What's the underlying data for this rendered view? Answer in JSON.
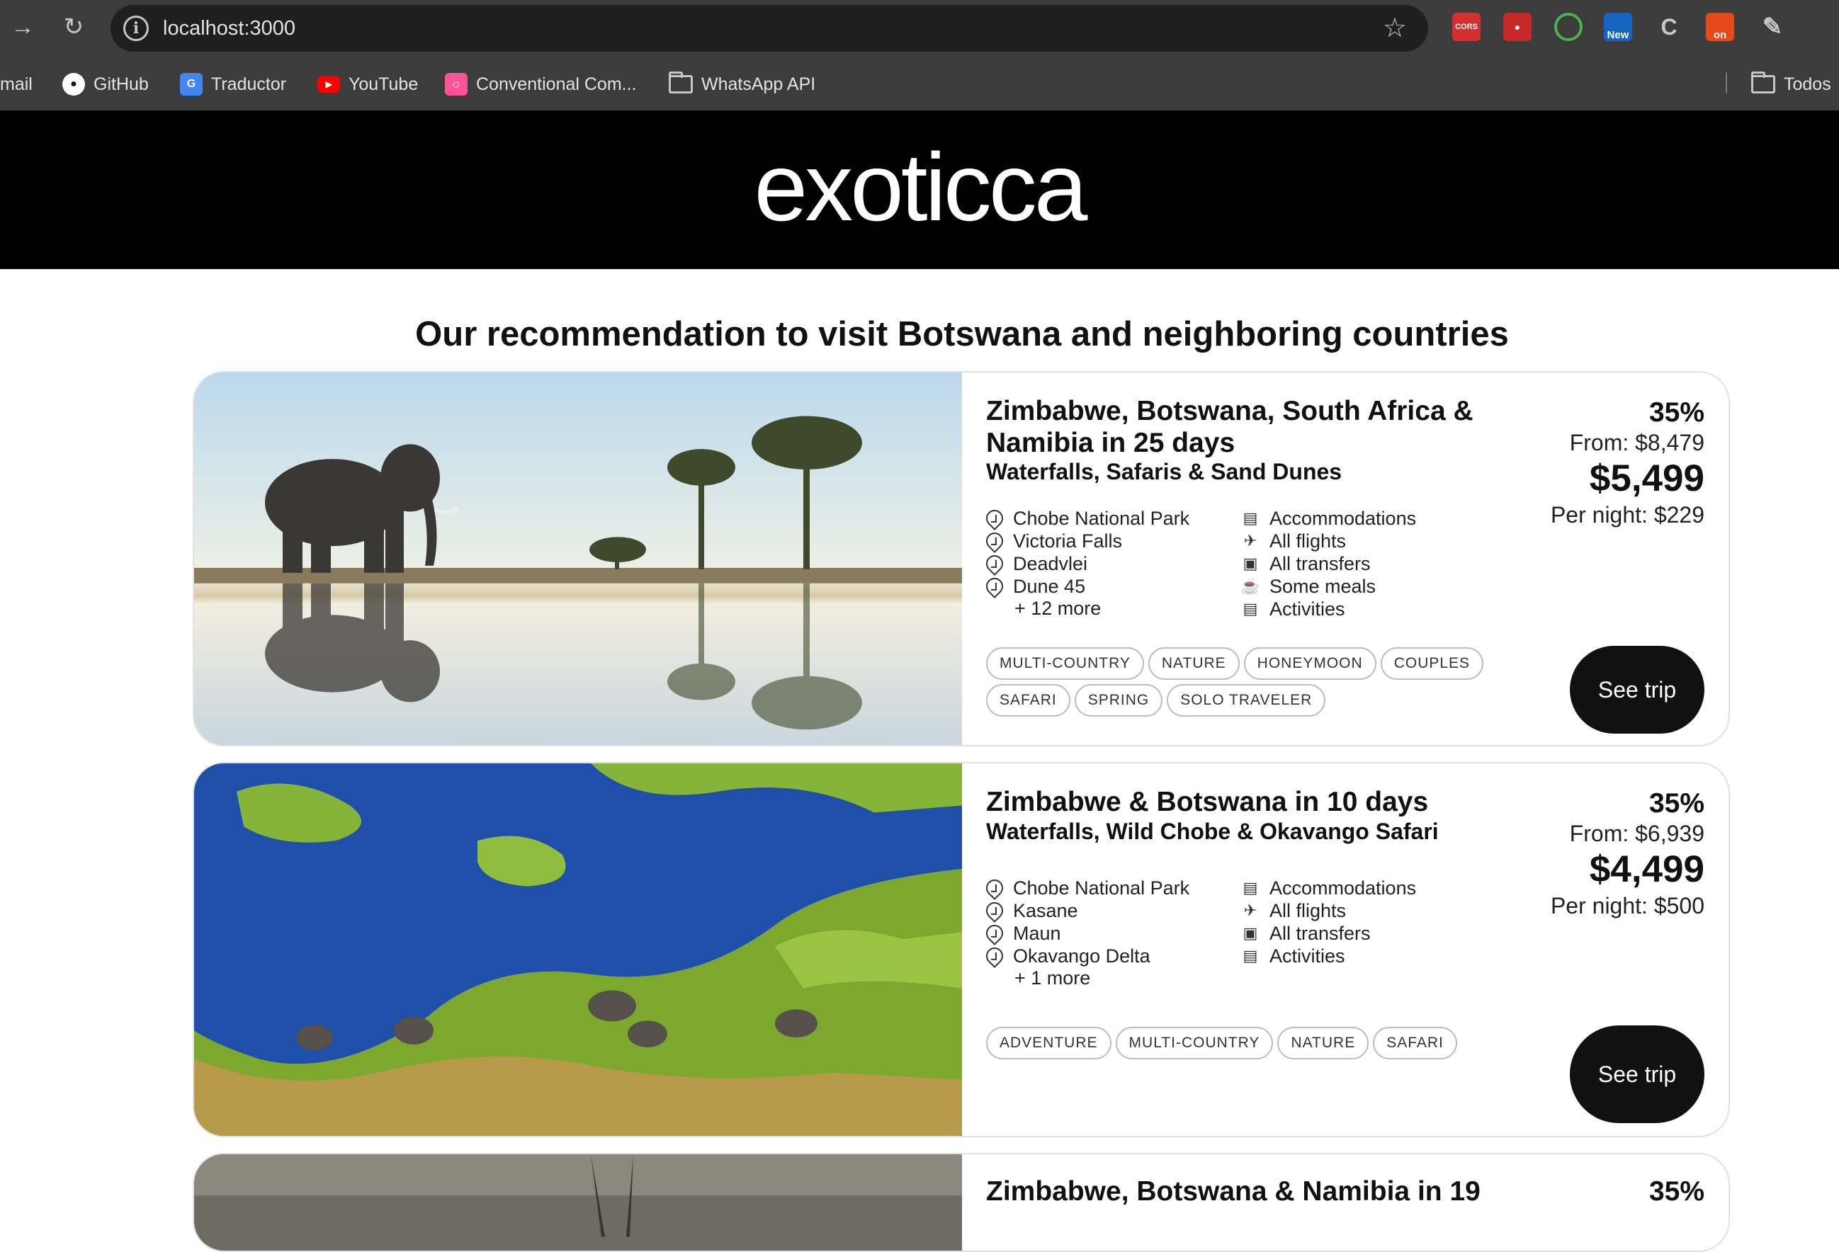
{
  "browser": {
    "url": "localhost:3000",
    "extensions": [
      {
        "name": "cors-extension-icon",
        "label": "CORS",
        "color": "#d32f2f"
      },
      {
        "name": "paw-extension-icon",
        "label": "",
        "color": "#c62828"
      },
      {
        "name": "target-extension-icon",
        "label": "",
        "color": "#2e7d32"
      },
      {
        "name": "new-extension-icon",
        "label": "New",
        "color": "#1565c0"
      },
      {
        "name": "c-extension-icon",
        "label": "C",
        "color": "#555555"
      },
      {
        "name": "on-extension-icon",
        "label": "on",
        "color": "#e64a19"
      }
    ],
    "bookmarks": {
      "gmail": "mail",
      "github": "GitHub",
      "traductor": "Traductor",
      "youtube": "YouTube",
      "conventional": "Conventional Com...",
      "whatsapp": "WhatsApp API",
      "todos": "Todos"
    }
  },
  "header": {
    "logo": "exoticca"
  },
  "page": {
    "title": "Our recommendation to visit Botswana and neighboring countries"
  },
  "trips": [
    {
      "title": "Zimbabwe, Botswana, South Africa & Namibia in 25 days",
      "subtitle": "Waterfalls, Safaris & Sand Dunes",
      "places": [
        "Chobe National Park",
        "Victoria Falls",
        "Deadvlei",
        "Dune 45"
      ],
      "more": "+ 12 more",
      "includes": [
        "Accommodations",
        "All flights",
        "All transfers",
        "Some meals",
        "Activities"
      ],
      "tags": [
        "Multi-country",
        "Nature",
        "Honeymoon",
        "Couples",
        "Safari",
        "Spring",
        "Solo traveler"
      ],
      "discount": "35%",
      "from": "From: $8,479",
      "price": "$5,499",
      "per_night": "Per night: $229",
      "cta": "See trip"
    },
    {
      "title": "Zimbabwe & Botswana in 10 days",
      "subtitle": "Waterfalls, Wild Chobe & Okavango Safari",
      "places": [
        "Chobe National Park",
        "Kasane",
        "Maun",
        "Okavango Delta"
      ],
      "more": "+ 1 more",
      "includes": [
        "Accommodations",
        "All flights",
        "All transfers",
        "Activities"
      ],
      "tags": [
        "Adventure",
        "Multi-country",
        "Nature",
        "Safari"
      ],
      "discount": "35%",
      "from": "From: $6,939",
      "price": "$4,499",
      "per_night": "Per night: $500",
      "cta": "See trip"
    },
    {
      "title": "Zimbabwe, Botswana & Namibia in 19",
      "discount": "35%"
    }
  ]
}
